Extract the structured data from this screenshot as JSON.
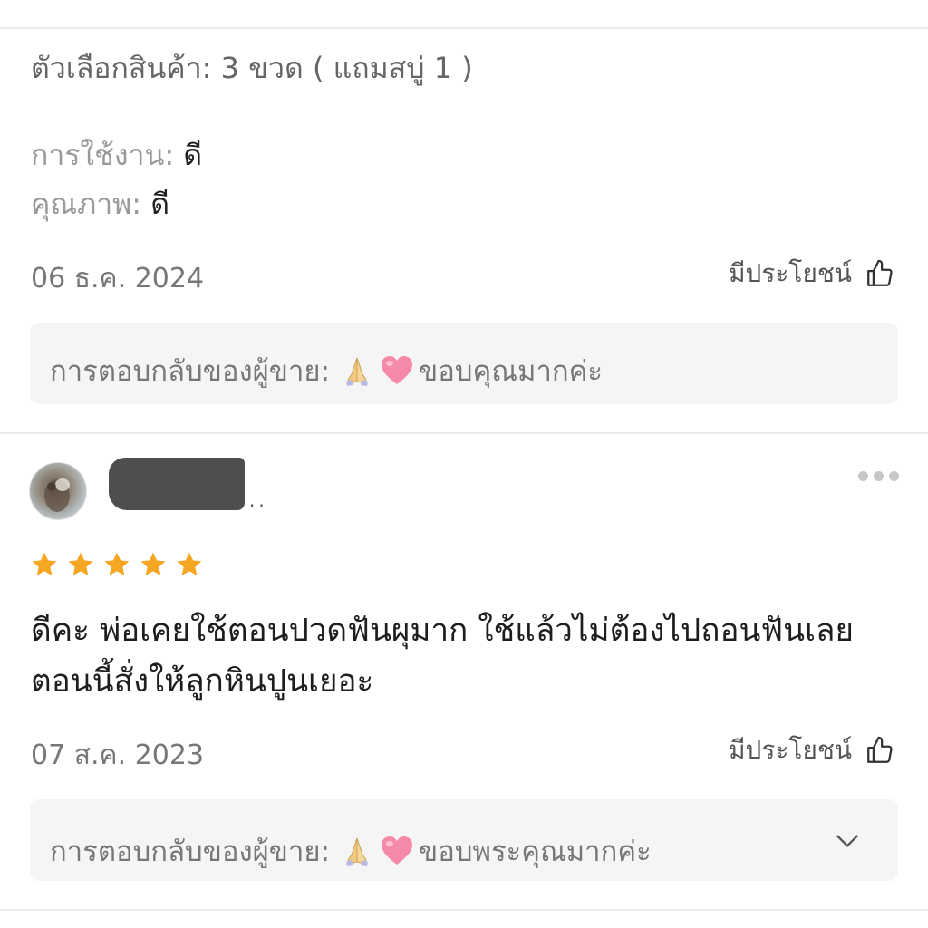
{
  "review1": {
    "option_label": "ตัวเลือกสินค้า: 3 ขวด ( แถมสบู่ 1 )",
    "usage_label": "การใช้งาน:",
    "usage_value": "ดี",
    "quality_label": "คุณภาพ:",
    "quality_value": "ดี",
    "date": "06 ธ.ค. 2024",
    "helpful_label": "มีประโยชน์",
    "seller_reply_label": "การตอบกลับของผู้ขาย:",
    "seller_reply_text": "ขอบคุณมากค่ะ",
    "reply_icons": [
      "folded-hands-icon",
      "pink-heart-icon"
    ]
  },
  "review2": {
    "rating": 5,
    "rating_max": 5,
    "text": "ดีคะ พ่อเคยใช้ตอนปวดฟันผุมาก ใช้แล้วไม่ต้องไปถอนฟันเลย ตอนนี้สั่งให้ลูกหินปูนเยอะ",
    "date": "07 ส.ค. 2023",
    "helpful_label": "มีประโยชน์",
    "seller_reply_label": "การตอบกลับของผู้ขาย:",
    "seller_reply_text": "ขอบพระคุณมากค่ะ",
    "reply_icons": [
      "folded-hands-icon",
      "pink-heart-icon"
    ]
  },
  "colors": {
    "star": "#f5a623",
    "reply_bg": "#f5f5f5",
    "divider": "#ececec"
  }
}
